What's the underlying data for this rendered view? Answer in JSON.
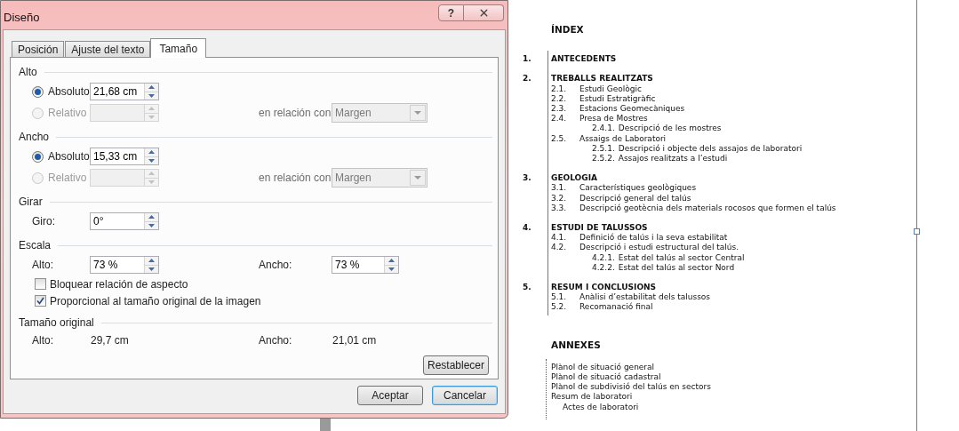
{
  "dialog": {
    "title": "Diseño",
    "help": "?",
    "tabs": [
      {
        "label": "Posición",
        "selected": false
      },
      {
        "label": "Ajuste del texto",
        "selected": false
      },
      {
        "label": "Tamaño",
        "selected": true
      }
    ],
    "sections": [
      {
        "kind": "size",
        "heading": "Alto",
        "options": [
          {
            "label": "Absoluto",
            "selected": true,
            "disabled": false,
            "value": "21,68 cm"
          },
          {
            "label": "Relativo",
            "selected": false,
            "disabled": true,
            "relation_label": "en relación con",
            "relation_value": "Margen"
          }
        ]
      },
      {
        "kind": "size",
        "heading": "Ancho",
        "options": [
          {
            "label": "Absoluto",
            "selected": true,
            "disabled": false,
            "value": "15,33 cm"
          },
          {
            "label": "Relativo",
            "selected": false,
            "disabled": true,
            "relation_label": "en relación con",
            "relation_value": "Margen"
          }
        ]
      },
      {
        "kind": "rotate",
        "heading": "Girar",
        "fields": [
          {
            "label": "Giro:",
            "value": "0°"
          }
        ]
      },
      {
        "kind": "scale",
        "heading": "Escala",
        "fields": [
          {
            "label": "Alto:",
            "value": "73 %"
          },
          {
            "label": "Ancho:",
            "value": "73 %"
          }
        ],
        "checkboxes": [
          {
            "label": "Bloquear relación de aspecto",
            "checked": false
          },
          {
            "label": "Proporcional al tamaño original de la imagen",
            "checked": true
          }
        ]
      },
      {
        "kind": "original",
        "heading": "Tamaño original",
        "pairs": [
          {
            "label": "Alto:",
            "value": "29,7 cm"
          },
          {
            "label": "Ancho:",
            "value": "21,01 cm"
          }
        ],
        "button": "Restablecer"
      }
    ],
    "buttons": [
      {
        "label": "Aceptar",
        "focused": false
      },
      {
        "label": "Cancelar",
        "focused": true
      }
    ]
  },
  "document": {
    "index": {
      "title": "ÍNDEX",
      "sections": [
        {
          "number": "1.",
          "title": "ANTECEDENTS"
        },
        {
          "number": "2.",
          "title": "TREBALLS REALITZATS",
          "children": [
            {
              "number": "2.1.",
              "title": "Estudi Geològic"
            },
            {
              "number": "2.2.",
              "title": "Estudi Estratigràfic"
            },
            {
              "number": "2.3.",
              "title": "Estacions Geomecàniques"
            },
            {
              "number": "2.4.",
              "title": "Presa de Mostres",
              "children": [
                {
                  "number": "2.4.1.",
                  "title": "Descripció de les mostres"
                }
              ]
            },
            {
              "number": "2.5.",
              "title": "Assaigs de Laboratori",
              "children": [
                {
                  "number": "2.5.1.",
                  "title": "Descripció i objecte dels assajos de laboratori"
                },
                {
                  "number": "2.5.2.",
                  "title": "Assajos realitzats a l’estudi"
                }
              ]
            }
          ]
        },
        {
          "number": "3.",
          "title": "GEOLOGIA",
          "children": [
            {
              "number": "3.1.",
              "title": "Característiques geològiques"
            },
            {
              "number": "3.2.",
              "title": "Descripció general del talús"
            },
            {
              "number": "3.3.",
              "title": "Descripció geotècnia dels materials rocosos que formen el talús"
            }
          ]
        },
        {
          "number": "4.",
          "title": "ESTUDI DE TALUSSOS",
          "children": [
            {
              "number": "4.1.",
              "title": "Definició de talús i la seva estabilitat"
            },
            {
              "number": "4.2.",
              "title": "Descripció i estudi estructural del talús.",
              "children": [
                {
                  "number": "4.2.1.",
                  "title": "Estat del talús al sector Central"
                },
                {
                  "number": "4.2.2.",
                  "title": "Estat del talús al sector Nord"
                }
              ]
            }
          ]
        },
        {
          "number": "5.",
          "title": "RESUM I CONCLUSIONS",
          "children": [
            {
              "number": "5.1.",
              "title": "Anàlisi d’estabilitat dels talussos"
            },
            {
              "number": "5.2.",
              "title": "Recomanació final"
            }
          ]
        }
      ]
    },
    "annexes": {
      "title": "ANNEXES",
      "items": [
        {
          "label": "Plànol de situació general"
        },
        {
          "label": "Plànol de situació cadastral"
        },
        {
          "label": "Plànol de subdivisió del talús en sectors"
        },
        {
          "label": "Resum de laboratori",
          "children": [
            {
              "label": "Actes de laboratori"
            }
          ]
        }
      ]
    }
  }
}
